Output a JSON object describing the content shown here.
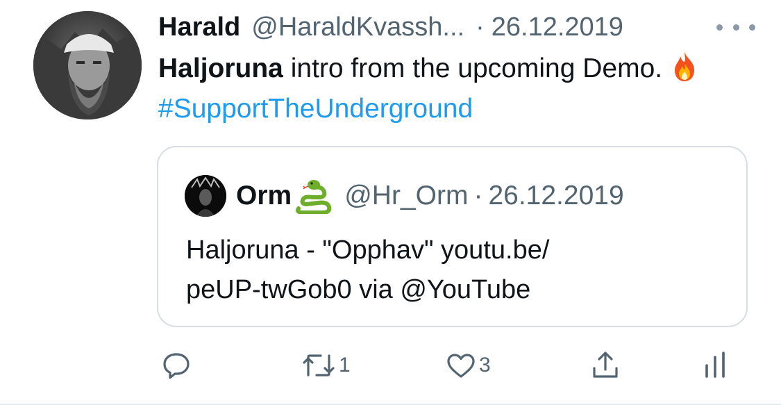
{
  "tweet": {
    "author_name": "Harald",
    "author_handle": "@HaraldKvassh...",
    "separator": "·",
    "date": "26.12.2019",
    "text_bold": "Haljoruna",
    "text_main": " intro from the upcoming Demo.",
    "hashtag": "#SupportTheUnderground"
  },
  "quote": {
    "author_name": "Orm",
    "author_handle": "@Hr_Orm",
    "separator": "·",
    "date": "26.12.2019",
    "text_line1": "Haljoruna - \"Opphav\" youtu.be/",
    "text_line2": "peUP-twGob0 via @YouTube"
  },
  "actions": {
    "retweet_count": "1",
    "like_count": "3"
  },
  "icons": {
    "reply": "reply-icon",
    "retweet": "retweet-icon",
    "like": "heart-icon",
    "share": "share-icon",
    "analytics": "analytics-icon",
    "more": "more-dots-icon"
  },
  "colors": {
    "text": "#0f1419",
    "secondary": "#536471",
    "link": "#1d9bf0",
    "border": "#d6dde3"
  }
}
